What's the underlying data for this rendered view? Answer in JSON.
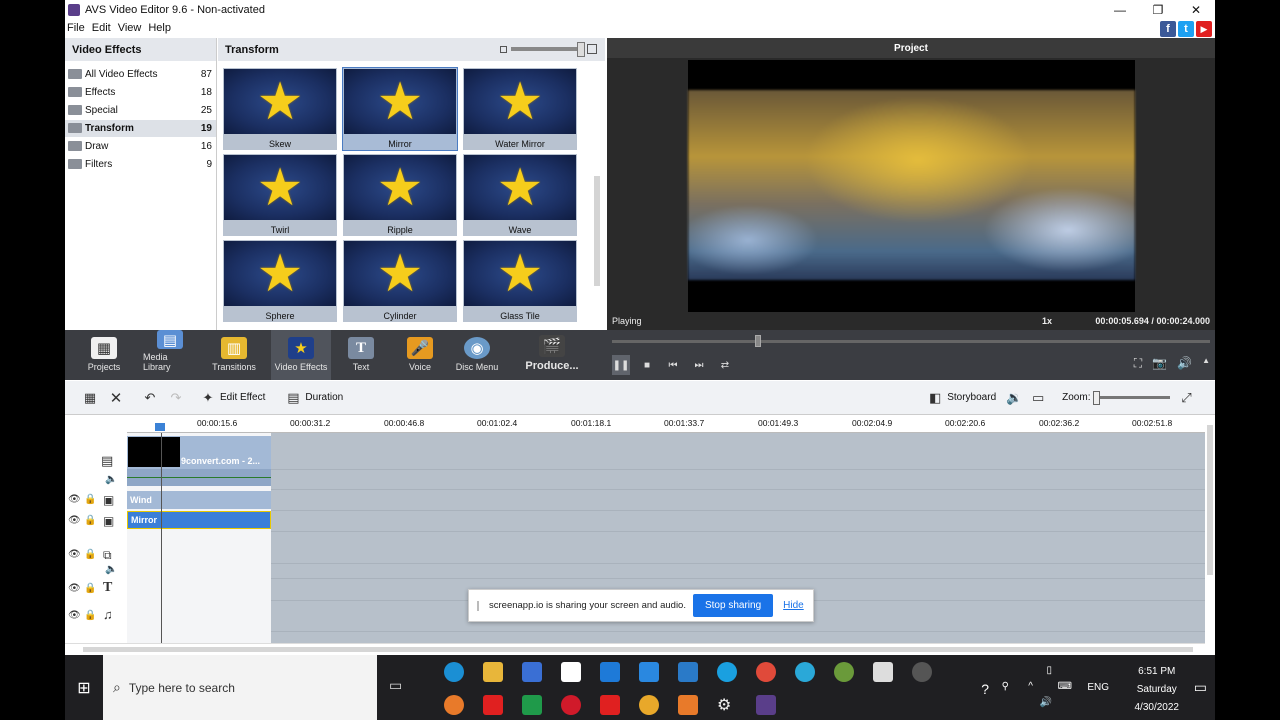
{
  "window": {
    "title": "AVS Video Editor 9.6 - Non-activated",
    "controls": {
      "minimize": "—",
      "restore": "❐",
      "close": "✕"
    }
  },
  "menu": [
    "File",
    "Edit",
    "View",
    "Help"
  ],
  "social": {
    "facebook": "f",
    "twitter": "t",
    "youtube": "▶"
  },
  "effects_panel": {
    "title": "Video Effects",
    "categories": [
      {
        "name": "All Video Effects",
        "count": "87"
      },
      {
        "name": "Effects",
        "count": "18"
      },
      {
        "name": "Special",
        "count": "25"
      },
      {
        "name": "Transform",
        "count": "19",
        "selected": true
      },
      {
        "name": "Draw",
        "count": "16"
      },
      {
        "name": "Filters",
        "count": "9"
      }
    ]
  },
  "transform_panel": {
    "title": "Transform",
    "tiles": [
      {
        "label": "Skew"
      },
      {
        "label": "Mirror",
        "selected": true
      },
      {
        "label": "Water Mirror"
      },
      {
        "label": "Twirl"
      },
      {
        "label": "Ripple"
      },
      {
        "label": "Wave"
      },
      {
        "label": "Sphere"
      },
      {
        "label": "Cylinder"
      },
      {
        "label": "Glass Tile"
      }
    ]
  },
  "preview": {
    "title": "Project",
    "status": "Playing",
    "speed": "1x",
    "time_current": "00:00:05.694",
    "time_separator": "/",
    "time_total": "00:00:24.000"
  },
  "tools": [
    {
      "label": "Projects",
      "color": "#f0f0f0",
      "icon": "projects-icon"
    },
    {
      "label": "Media Library",
      "color": "#5b8fd4",
      "icon": "film-icon"
    },
    {
      "label": "Transitions",
      "color": "#e6b830",
      "icon": "transitions-icon"
    },
    {
      "label": "Video Effects",
      "color": "#1f3f8a",
      "icon": "star-icon",
      "selected": true
    },
    {
      "label": "Text",
      "color": "#7a8aa0",
      "icon": "text-icon"
    },
    {
      "label": "Voice",
      "color": "#e69a20",
      "icon": "mic-icon"
    },
    {
      "label": "Disc Menu",
      "color": "#6a9ac8",
      "icon": "disc-icon"
    },
    {
      "label": "Produce...",
      "color": "#444",
      "icon": "clapper-icon"
    }
  ],
  "timeline_toolbar": {
    "edit_effect": "Edit Effect",
    "duration": "Duration",
    "storyboard": "Storyboard",
    "zoom": "Zoom:"
  },
  "ruler": [
    "00:00:15.6",
    "00:00:31.2",
    "00:00:46.8",
    "00:01:02.4",
    "00:01:18.1",
    "00:01:33.7",
    "00:01:49.3",
    "00:02:04.9",
    "00:02:20.6",
    "00:02:36.2",
    "00:02:51.8"
  ],
  "tracks": {
    "clip_name": "9convert.com - 2...",
    "fx1": "Wind",
    "fx2": "Mirror"
  },
  "share_banner": {
    "message": "screenapp.io is sharing your screen and audio.",
    "stop": "Stop sharing",
    "hide": "Hide"
  },
  "taskbar": {
    "search_placeholder": "Type here to search",
    "time": "6:51 PM",
    "day": "Saturday",
    "date": "4/30/2022",
    "lang": "ENG"
  }
}
